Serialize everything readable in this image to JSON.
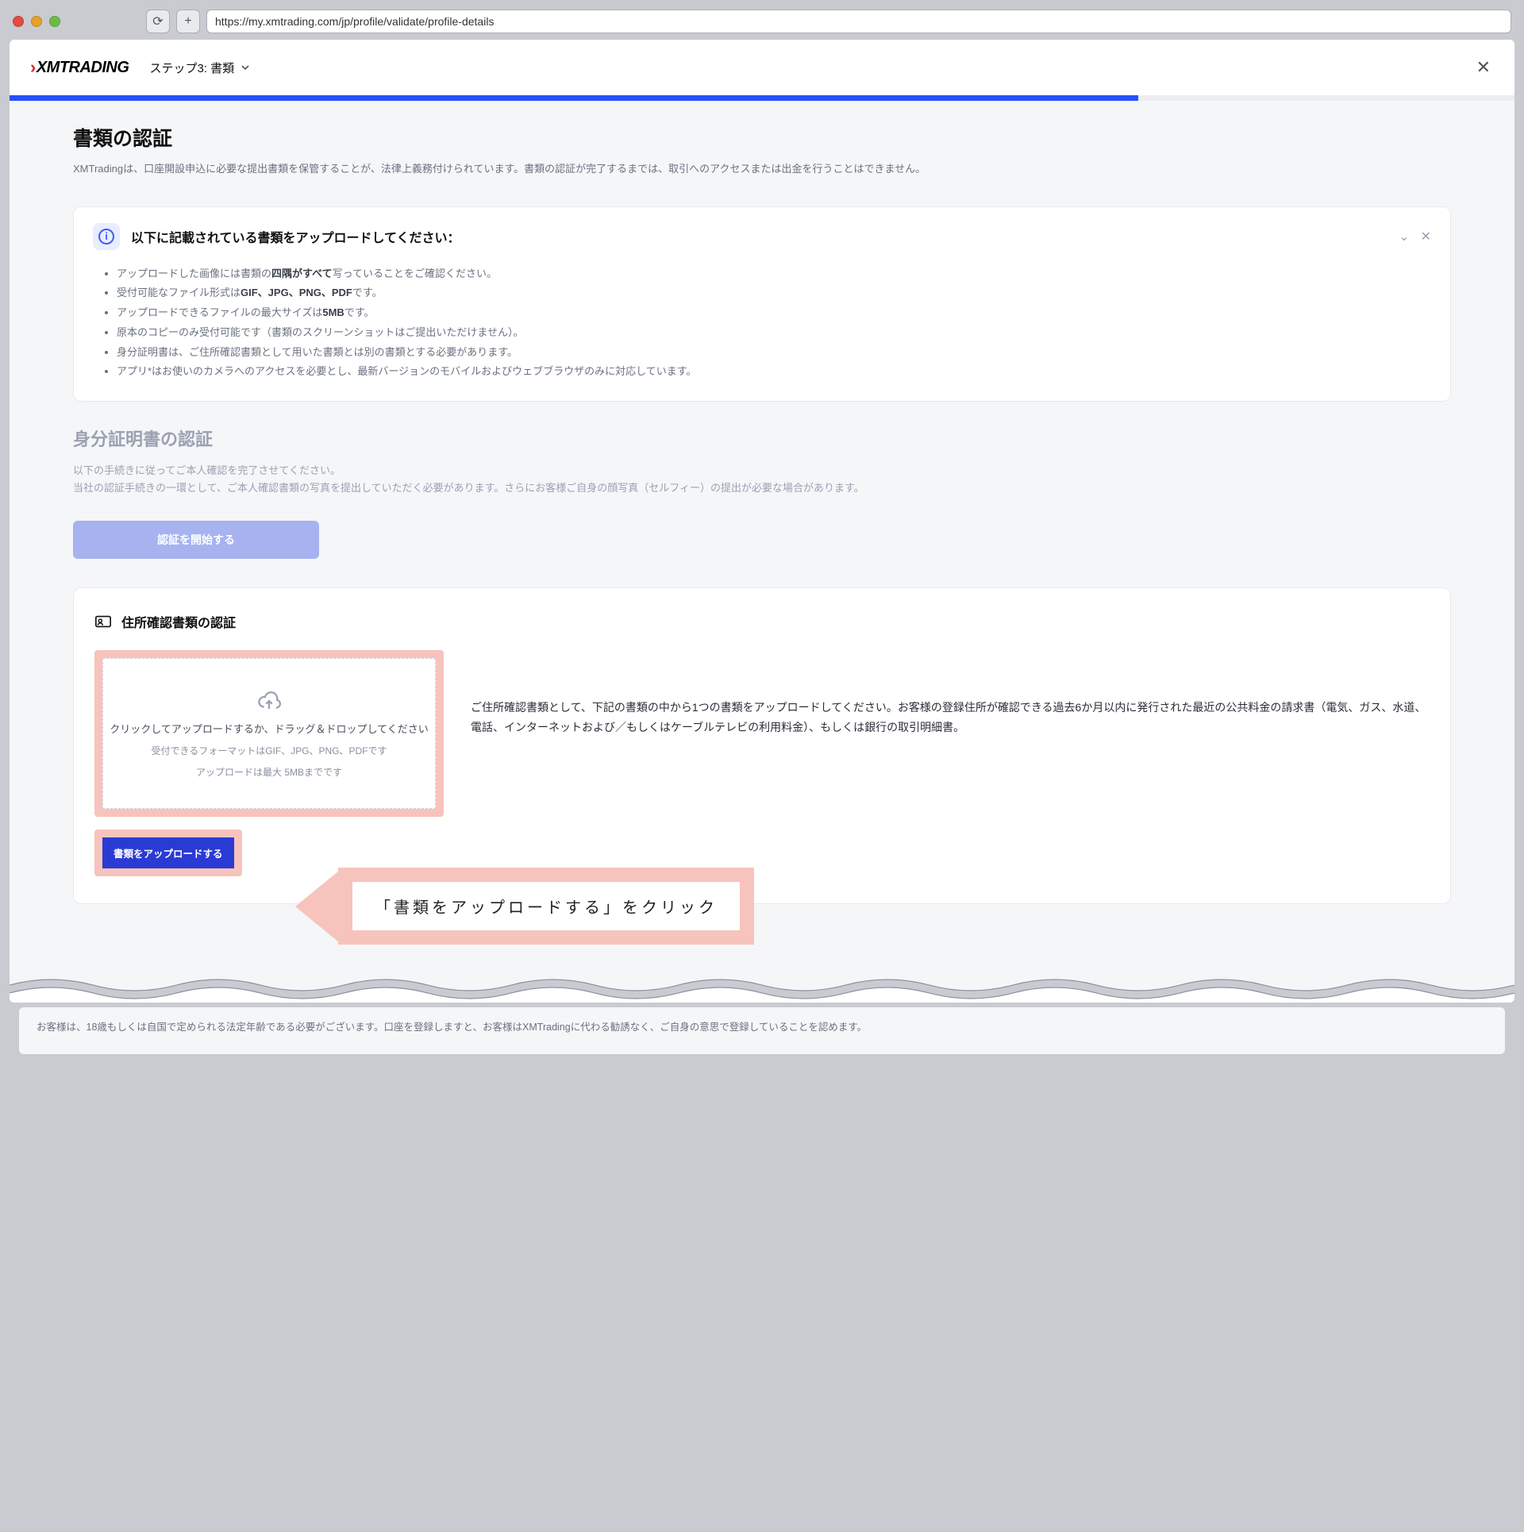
{
  "browser": {
    "url": "https://my.xmtrading.com/jp/profile/validate/profile-details"
  },
  "header": {
    "logo_text": "XMTRADING",
    "step_label": "ステップ3: 書類"
  },
  "progress": {
    "percent": 75
  },
  "page": {
    "title": "書類の認証",
    "subtitle": "XMTradingは、口座開設申込に必要な提出書類を保管することが、法律上義務付けられています。書類の認証が完了するまでは、取引へのアクセスまたは出金を行うことはできません。"
  },
  "info": {
    "title": "以下に記載されている書類をアップロードしてください：",
    "items": [
      {
        "pre": "アップロードした画像には書類の",
        "bold": "四隅がすべて",
        "post": "写っていることをご確認ください。"
      },
      {
        "pre": "受付可能なファイル形式は",
        "bold": "GIF、JPG、PNG、PDF",
        "post": "です。"
      },
      {
        "pre": "アップロードできるファイルの最大サイズは",
        "bold": "5MB",
        "post": "です。"
      },
      {
        "pre": "原本のコピーのみ受付可能です（書類のスクリーンショットはご提出いただけません）。",
        "bold": "",
        "post": ""
      },
      {
        "pre": "身分証明書は、ご住所確認書類として用いた書類とは別の書類とする必要があります。",
        "bold": "",
        "post": ""
      },
      {
        "pre": "アプリ*はお使いのカメラへのアクセスを必要とし、最新バージョンのモバイルおよびウェブブラウザのみに対応しています。",
        "bold": "",
        "post": ""
      }
    ]
  },
  "id_section": {
    "title": "身分証明書の認証",
    "sub1": "以下の手続きに従ってご本人確認を完了させてください。",
    "sub2": "当社の認証手続きの一環として、ご本人確認書類の写真を提出していただく必要があります。さらにお客様ご自身の顔写真（セルフィー）の提出が必要な場合があります。",
    "button": "認証を開始する"
  },
  "addr_section": {
    "title": "住所確認書類の認証",
    "upload_t1": "クリックしてアップロードするか、ドラッグ＆ドロップしてください",
    "upload_t2": "受付できるフォーマットはGIF、JPG、PNG、PDFです",
    "upload_t3": "アップロードは最大 5MBまでです",
    "desc": "ご住所確認書類として、下記の書類の中から1つの書類をアップロードしてください。お客様の登録住所が確認できる過去6か月以内に発行された最近の公共料金の請求書（電気、ガス、水道、電話、インターネットおよび／もしくはケーブルテレビの利用料金）、もしくは銀行の取引明細書。",
    "button": "書類をアップロードする"
  },
  "annotation": {
    "text": "「書類をアップロードする」をクリック"
  },
  "footer": {
    "note": "お客様は、18歳もしくは自国で定められる法定年齢である必要がございます。口座を登録しますと、お客様はXMTradingに代わる勧誘なく、ご自身の意思で登録していることを認めます。"
  }
}
